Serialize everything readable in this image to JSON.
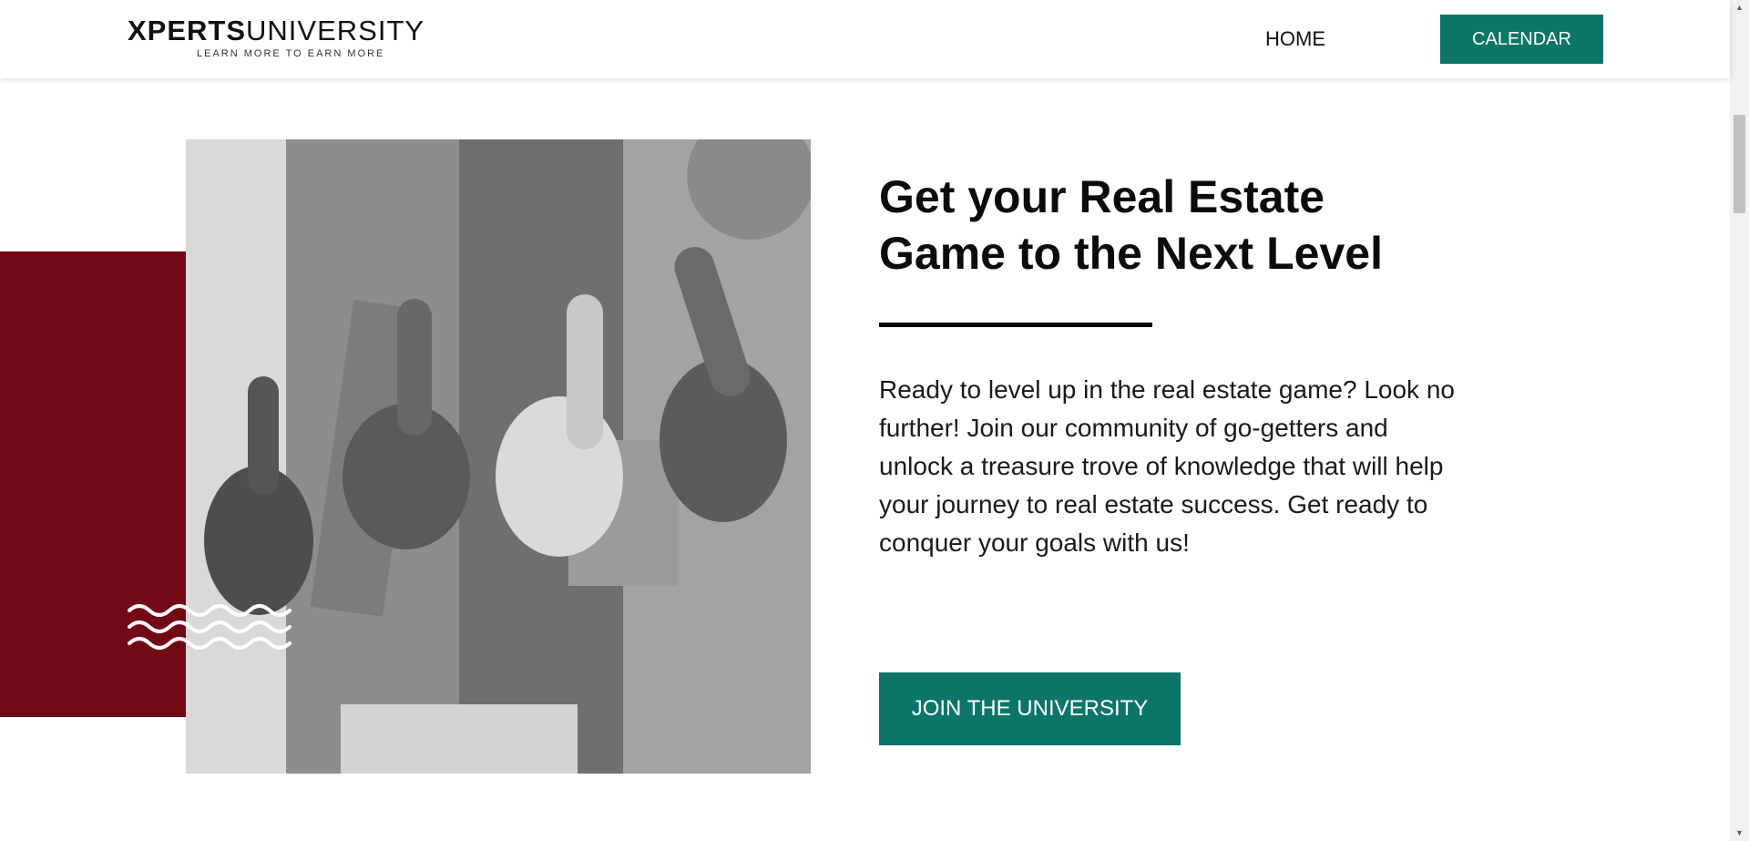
{
  "header": {
    "logo": {
      "bold": "XPERTS",
      "light": "UNIVERSITY",
      "tagline": "LEARN MORE TO EARN MORE"
    },
    "nav": {
      "home": "HOME",
      "calendar": "CALENDAR"
    }
  },
  "hero": {
    "heading_line1": "Get your Real Estate",
    "heading_line2": "Game to the Next Level",
    "description_lines": [
      "Ready to level up in the real estate game? Look no",
      "further! Join our community of go-getters and",
      "unlock a treasure trove of knowledge that will help",
      "your journey to real estate success. Get ready to",
      "conquer your goals with us!"
    ],
    "cta": "JOIN THE UNIVERSITY",
    "image_subject": "group-thumbs-up-photo"
  },
  "colors": {
    "accent_teal": "#0b7667",
    "brand_red": "#710a16",
    "text_dark": "#0b0b0b"
  }
}
